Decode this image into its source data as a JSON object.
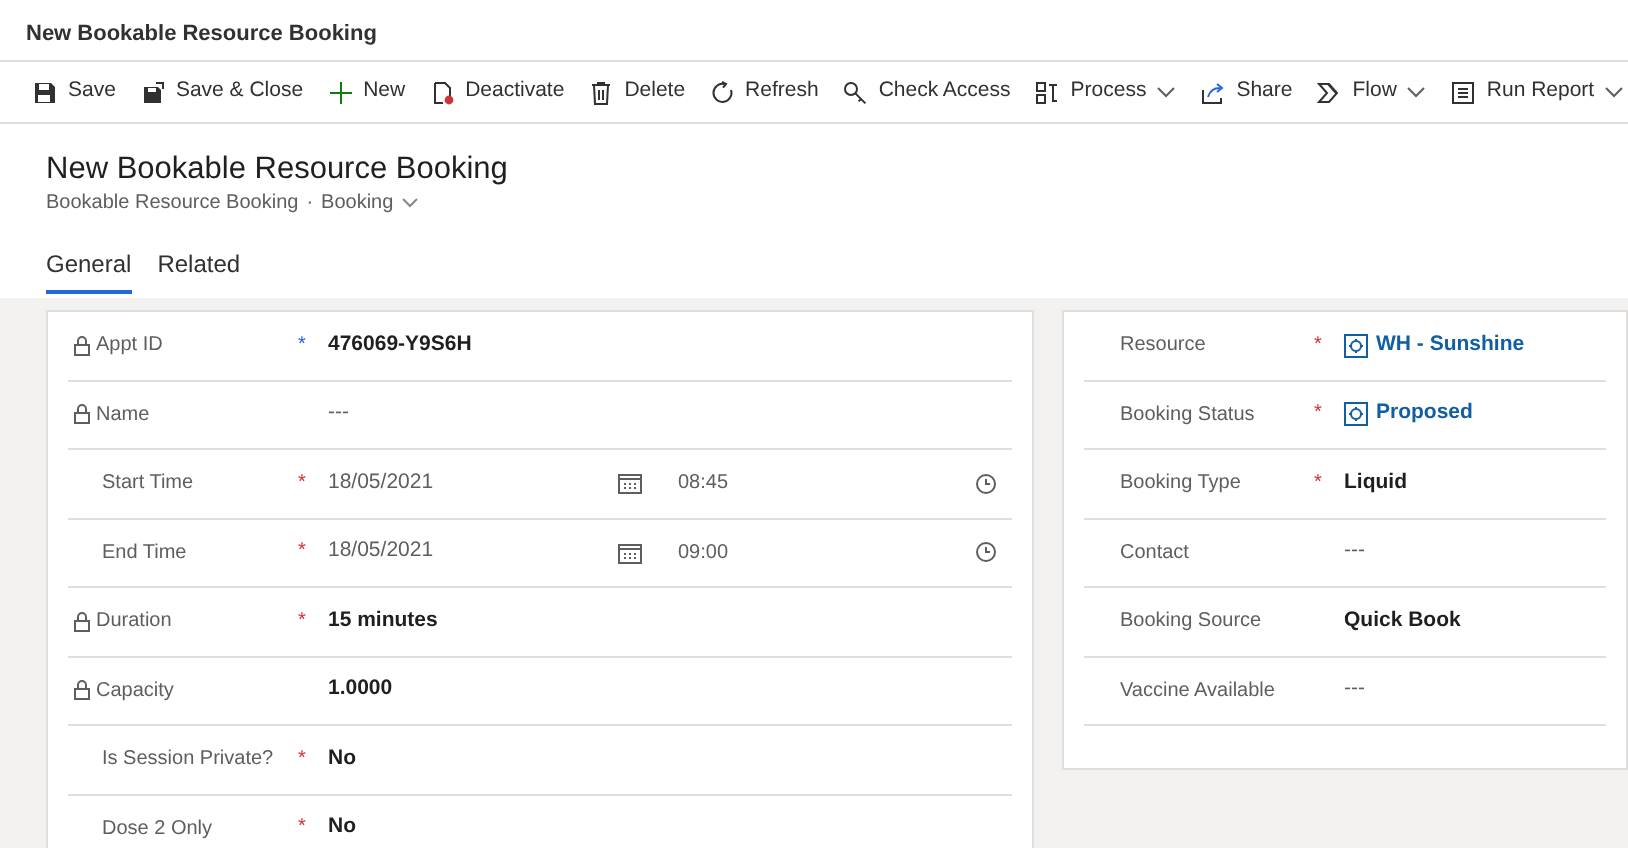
{
  "app_title": "New Bookable Resource Booking",
  "toolbar": [
    {
      "label": "Save",
      "has_menu": false
    },
    {
      "label": "Save & Close",
      "has_menu": false
    },
    {
      "label": "New",
      "has_menu": false
    },
    {
      "label": "Deactivate",
      "has_menu": false
    },
    {
      "label": "Delete",
      "has_menu": false
    },
    {
      "label": "Refresh",
      "has_menu": false
    },
    {
      "label": "Check Access",
      "has_menu": false
    },
    {
      "label": "Process",
      "has_menu": true
    },
    {
      "label": "Share",
      "has_menu": false
    },
    {
      "label": "Flow",
      "has_menu": true
    },
    {
      "label": "Run Report",
      "has_menu": true
    }
  ],
  "record": {
    "title": "New Bookable Resource Booking",
    "entity": "Bookable Resource Booking",
    "separator": "·",
    "form": "Booking"
  },
  "tabs": [
    {
      "label": "General",
      "selected": true
    },
    {
      "label": "Related",
      "selected": false
    }
  ],
  "left_section": [
    {
      "label": "Appt ID",
      "locked": true,
      "marker": {
        "text": "*",
        "color": "#2266e3"
      },
      "kind": "text",
      "value": "476069-Y9S6H"
    },
    {
      "label": "Name",
      "locked": true,
      "kind": "empty",
      "value": "---"
    },
    {
      "label": "Start Time",
      "locked": false,
      "marker": {
        "text": "*",
        "color": "#d13438"
      },
      "kind": "datetime",
      "value": "18/05/2021",
      "time": "08:45"
    },
    {
      "label": "End Time",
      "locked": false,
      "marker": {
        "text": "*",
        "color": "#d13438"
      },
      "kind": "datetime",
      "value": "18/05/2021",
      "time": "09:00"
    },
    {
      "label": "Duration",
      "locked": true,
      "marker": {
        "text": "*",
        "color": "#d13438"
      },
      "kind": "text",
      "value": "15 minutes"
    },
    {
      "label": "Capacity",
      "locked": true,
      "kind": "text",
      "value": "1.0000"
    },
    {
      "label": "Is Session Private?",
      "locked": false,
      "marker": {
        "text": "*",
        "color": "#d13438"
      },
      "kind": "text",
      "value": "No"
    },
    {
      "label": "Dose 2 Only",
      "locked": false,
      "marker": {
        "text": "*",
        "color": "#d13438"
      },
      "kind": "text",
      "value": "No"
    }
  ],
  "right_section": [
    {
      "label": "Resource",
      "marker": {
        "text": "*",
        "color": "#d13438"
      },
      "kind": "lookup",
      "value": "WH - Sunshine"
    },
    {
      "label": "Booking Status",
      "marker": {
        "text": "*",
        "color": "#d13438"
      },
      "kind": "lookup",
      "value": "Proposed"
    },
    {
      "label": "Booking Type",
      "marker": {
        "text": "*",
        "color": "#d13438"
      },
      "kind": "text",
      "value": "Liquid"
    },
    {
      "label": "Contact",
      "kind": "empty",
      "value": "---"
    },
    {
      "label": "Booking Source",
      "kind": "text",
      "value": "Quick Book"
    },
    {
      "label": "Vaccine Available",
      "kind": "empty",
      "value": "---"
    }
  ]
}
